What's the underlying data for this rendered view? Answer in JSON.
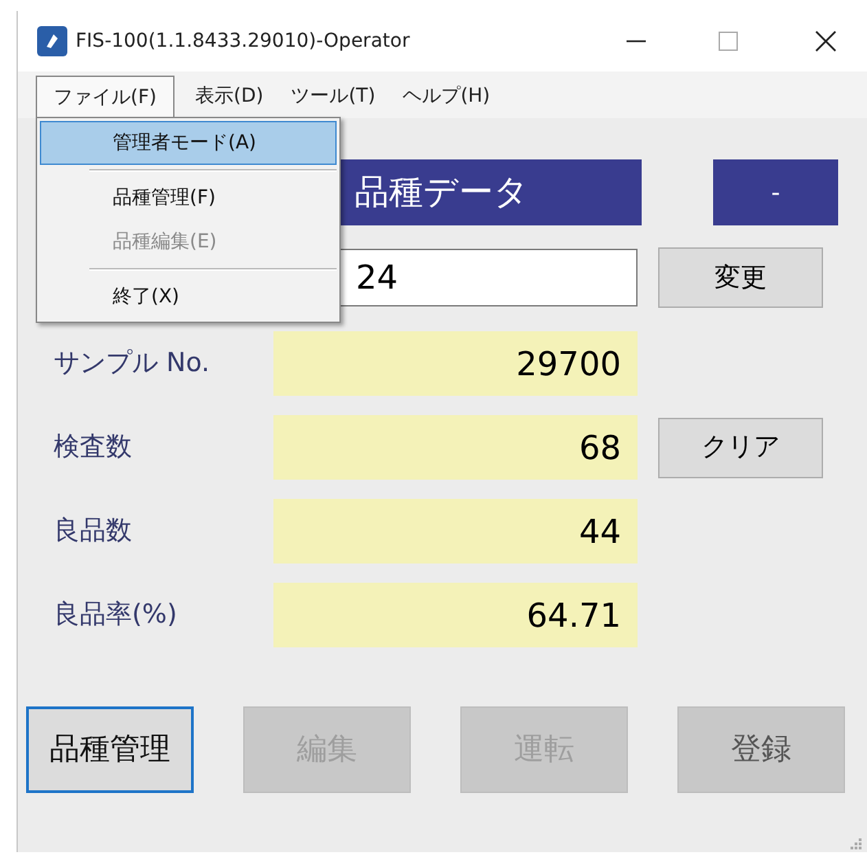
{
  "window": {
    "title": "FIS-100(1.1.8433.29010)-Operator"
  },
  "menu_bar": [
    {
      "label": "ファイル(F)",
      "selected": true
    },
    {
      "label": "表示(D)",
      "selected": false
    },
    {
      "label": "ツール(T)",
      "selected": false
    },
    {
      "label": "ヘルプ(H)",
      "selected": false
    }
  ],
  "file_menu": [
    {
      "kind": "item",
      "label": "管理者モード(A)",
      "selected": true,
      "disabled": false
    },
    {
      "kind": "separator"
    },
    {
      "kind": "item",
      "label": "品種管理(F)",
      "selected": false,
      "disabled": false
    },
    {
      "kind": "item",
      "label": "品種編集(E)",
      "selected": false,
      "disabled": true
    },
    {
      "kind": "separator"
    },
    {
      "kind": "item",
      "label": "終了(X)",
      "selected": false,
      "disabled": false
    }
  ],
  "header": {
    "title": "品種データ",
    "badge": "-"
  },
  "product_field": {
    "value": "24"
  },
  "change_button": "変更",
  "stats": [
    {
      "label": "サンプル No.",
      "value": "29700"
    },
    {
      "label": "検査数",
      "value": "68",
      "button": "クリア"
    },
    {
      "label": "良品数",
      "value": "44"
    },
    {
      "label": "良品率(%)",
      "value": "64.71"
    }
  ],
  "buttons": [
    {
      "label": "品種管理",
      "focused": true,
      "disabled": false
    },
    {
      "label": "編集",
      "focused": false,
      "disabled": true
    },
    {
      "label": "運転",
      "focused": false,
      "disabled": true
    },
    {
      "label": "登録",
      "focused": false,
      "disabled": false
    }
  ]
}
